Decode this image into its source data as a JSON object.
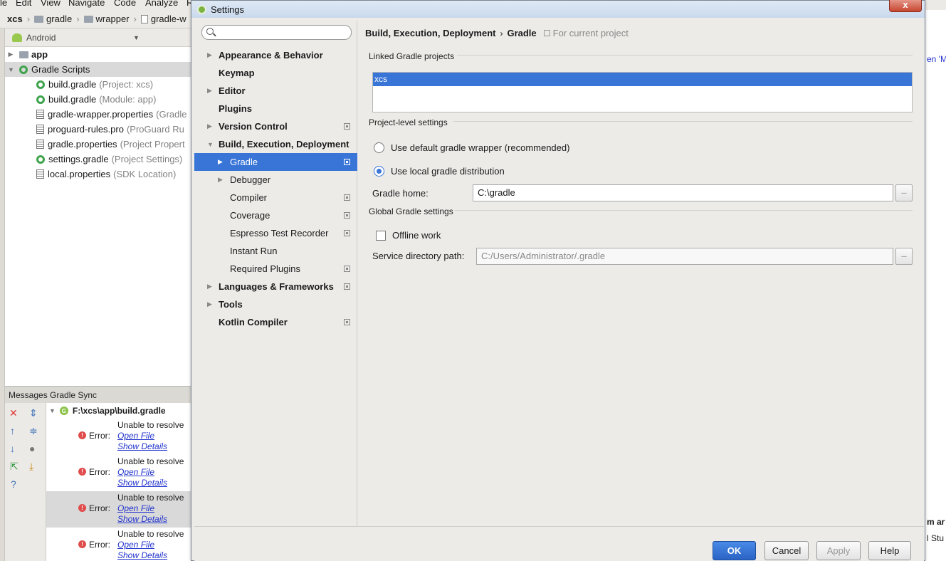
{
  "ide": {
    "menu": [
      {
        "label": "le"
      },
      {
        "label": "Edit"
      },
      {
        "label": "View"
      },
      {
        "label": "Navigate"
      },
      {
        "label": "Code"
      },
      {
        "label": "Analyze"
      },
      {
        "label": "R"
      }
    ],
    "breadcrumb": [
      "xcs",
      "gradle",
      "wrapper",
      "gradle-w"
    ],
    "project_view": {
      "mode": "Android",
      "items": [
        {
          "label": "app",
          "hint": ""
        },
        {
          "label": "Gradle Scripts",
          "hint": ""
        },
        {
          "label": "build.gradle",
          "hint": "(Project: xcs)"
        },
        {
          "label": "build.gradle",
          "hint": "(Module: app)"
        },
        {
          "label": "gradle-wrapper.properties",
          "hint": "(Gradle"
        },
        {
          "label": "proguard-rules.pro",
          "hint": "(ProGuard Ru"
        },
        {
          "label": "gradle.properties",
          "hint": "(Project Propert"
        },
        {
          "label": "settings.gradle",
          "hint": "(Project Settings)"
        },
        {
          "label": "local.properties",
          "hint": "(SDK Location)"
        }
      ]
    },
    "messages": {
      "title": "Messages Gradle Sync",
      "root": "F:\\xcs\\app\\build.gradle",
      "root_badge": "G",
      "items": [
        {
          "error": "Error:",
          "text": "Unable to resolve",
          "open": "Open File",
          "details": "Show Details"
        },
        {
          "error": "Error:",
          "text": "Unable to resolve",
          "open": "Open File",
          "details": "Show Details"
        },
        {
          "error": "Error:",
          "text": "Unable to resolve",
          "open": "Open File",
          "details": "Show Details"
        },
        {
          "error": "Error:",
          "text": "Unable to resolve",
          "open": "Open File",
          "details": "Show Details"
        }
      ]
    },
    "right_fragments": {
      "top": "en 'M",
      "bottom1": "m ar",
      "bottom2": "l Stu"
    }
  },
  "dialog": {
    "title": "Settings",
    "close": "x",
    "search": {
      "value": "",
      "placeholder": ""
    },
    "nav": [
      {
        "label": "Appearance & Behavior"
      },
      {
        "label": "Keymap"
      },
      {
        "label": "Editor"
      },
      {
        "label": "Plugins"
      },
      {
        "label": "Version Control"
      },
      {
        "label": "Build, Execution, Deployment"
      },
      {
        "label": "Gradle"
      },
      {
        "label": "Debugger"
      },
      {
        "label": "Compiler"
      },
      {
        "label": "Coverage"
      },
      {
        "label": "Espresso Test Recorder"
      },
      {
        "label": "Instant Run"
      },
      {
        "label": "Required Plugins"
      },
      {
        "label": "Languages & Frameworks"
      },
      {
        "label": "Tools"
      },
      {
        "label": "Kotlin Compiler"
      }
    ],
    "header": {
      "section": "Build, Execution, Deployment",
      "separator": "›",
      "page": "Gradle",
      "scope": "For current project"
    },
    "linked_title": "Linked Gradle projects",
    "linked_projects": [
      "xcs"
    ],
    "project_level_title": "Project-level settings",
    "radio_default": "Use default gradle wrapper (recommended)",
    "radio_local": "Use local gradle distribution",
    "gradle_home_label": "Gradle home:",
    "gradle_home_value": "C:\\gradle",
    "global_title": "Global Gradle settings",
    "offline_label": "Offline work",
    "service_label": "Service directory path:",
    "service_value": "C:/Users/Administrator/.gradle",
    "browse": "...",
    "buttons": {
      "ok": "OK",
      "cancel": "Cancel",
      "apply": "Apply",
      "help": "Help"
    }
  }
}
